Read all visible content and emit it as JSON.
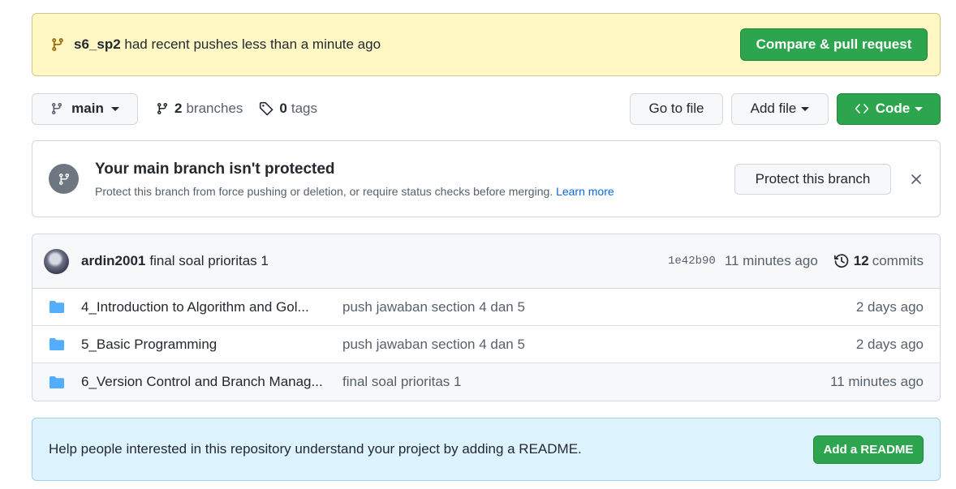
{
  "push_banner": {
    "branch": "s6_sp2",
    "message": " had recent pushes less than a minute ago",
    "button": "Compare & pull request"
  },
  "nav": {
    "branch_selector": "main",
    "branches_count": "2",
    "branches_label": "branches",
    "tags_count": "0",
    "tags_label": "tags",
    "go_to_file": "Go to file",
    "add_file": "Add file",
    "code": "Code"
  },
  "protect": {
    "title": "Your main branch isn't protected",
    "description": "Protect this branch from force pushing or deletion, or require status checks before merging.",
    "learn_more": "Learn more",
    "button": "Protect this branch"
  },
  "latest_commit": {
    "author": "ardin2001",
    "message": "final soal prioritas 1",
    "sha": "1e42b90",
    "time": "11 minutes ago",
    "commits_count": "12",
    "commits_label": "commits"
  },
  "files": [
    {
      "name": "4_Introduction to Algorithm and Gol...",
      "commit": "push jawaban section 4 dan 5",
      "age": "2 days ago"
    },
    {
      "name": "5_Basic Programming",
      "commit": "push jawaban section 4 dan 5",
      "age": "2 days ago"
    },
    {
      "name": "6_Version Control and Branch Manag...",
      "commit": "final soal prioritas 1",
      "age": "11 minutes ago"
    }
  ],
  "readme": {
    "text": "Help people interested in this repository understand your project by adding a README.",
    "button": "Add a README"
  },
  "colors": {
    "green": "#2da44e",
    "banner_yellow": "#fff8c5",
    "readme_blue": "#ddf4ff",
    "folder_blue": "#54aeff",
    "link_blue": "#0969da"
  }
}
